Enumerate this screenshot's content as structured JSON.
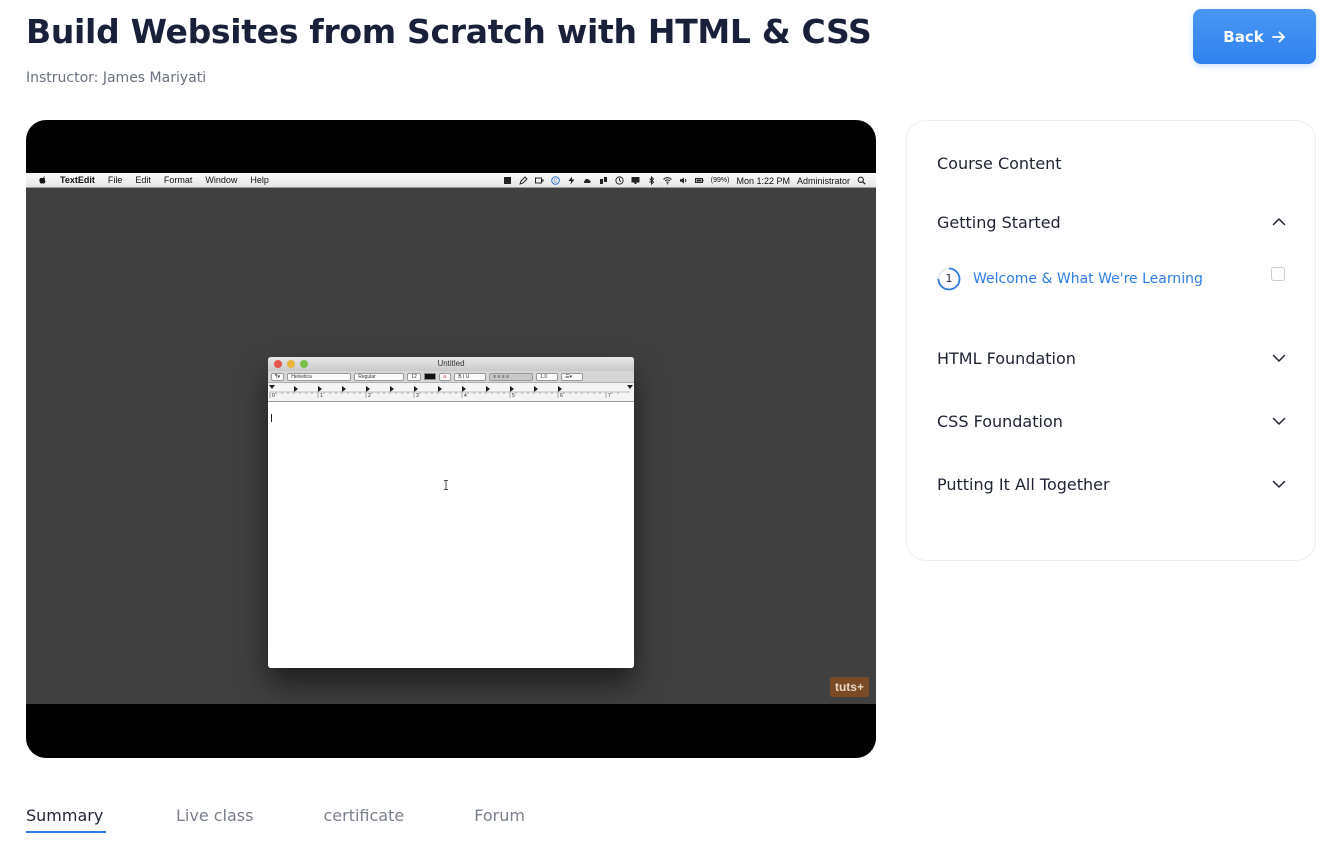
{
  "header": {
    "title": "Build Websites from Scratch with HTML & CSS",
    "instructor": "Instructor: James Mariyati",
    "back_label": "Back",
    "back_icon": "arrow-right-icon"
  },
  "video": {
    "menubar": {
      "app": "TextEdit",
      "menus": [
        "File",
        "Edit",
        "Format",
        "Window",
        "Help"
      ],
      "battery": "(99%)",
      "clock": "Mon 1:22 PM",
      "user": "Administrator"
    },
    "window_title": "Untitled",
    "toolbar": {
      "font": "Helvetica",
      "style": "Regular",
      "size": "12",
      "spacing": "1.0"
    },
    "ruler_numbers": [
      "0",
      "1",
      "2",
      "3",
      "4",
      "5",
      "6",
      "7"
    ],
    "watermark": "tuts+"
  },
  "sidebar": {
    "title": "Course Content",
    "sections": [
      {
        "label": "Getting Started",
        "expanded": true,
        "lessons": [
          {
            "number": "1",
            "label": "Welcome & What We're Learning",
            "completed": false
          }
        ]
      },
      {
        "label": "HTML Foundation",
        "expanded": false
      },
      {
        "label": "CSS Foundation",
        "expanded": false
      },
      {
        "label": "Putting It All Together",
        "expanded": false
      }
    ]
  },
  "tabs": [
    {
      "label": "Summary",
      "active": true
    },
    {
      "label": "Live class",
      "active": false
    },
    {
      "label": "certificate",
      "active": false
    },
    {
      "label": "Forum",
      "active": false
    }
  ],
  "colors": {
    "accent": "#2f7de0",
    "button": "#3b8cf2",
    "title": "#18203a",
    "muted": "#6b7280"
  }
}
